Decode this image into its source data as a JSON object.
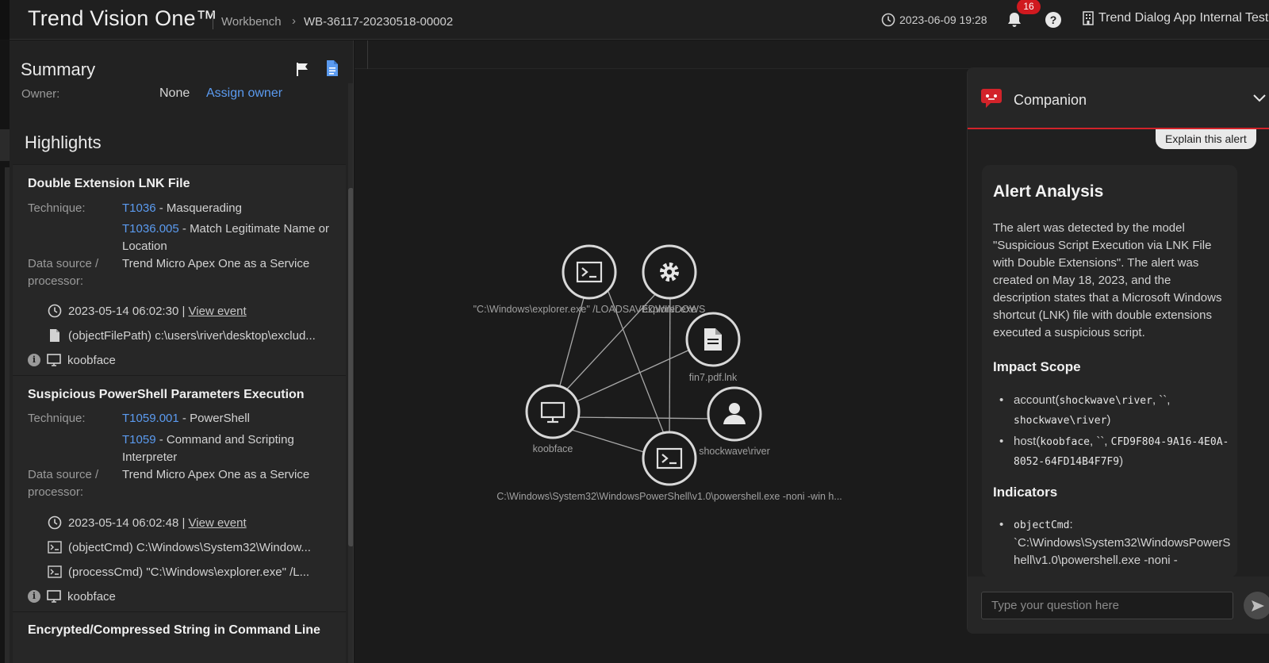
{
  "topbar": {
    "app_title": "Trend Vision One™",
    "breadcrumb_workbench": "Workbench",
    "breadcrumb_separator": "›",
    "breadcrumb_id": "WB-36117-20230518-00002",
    "datetime": "2023-06-09 19:28",
    "notification_count": "16",
    "help_label": "?",
    "tenant_name": "Trend Dialog App Internal Test"
  },
  "summary": {
    "title": "Summary",
    "owner_label": "Owner:",
    "owner_value": "None",
    "assign_owner": "Assign owner"
  },
  "highlights": {
    "title": "Highlights",
    "cards": [
      {
        "title": "Double Extension LNK File",
        "technique_label": "Technique:",
        "techniques": [
          {
            "id": "T1036",
            "name": " - Masquerading"
          },
          {
            "id": "T1036.005",
            "name": " - Match Legitimate Name or Location"
          }
        ],
        "source_label": "Data source / processor:",
        "source_value": "Trend Micro Apex One as a Service",
        "event_time": "2023-05-14 06:02:30 | ",
        "view_event": "View event",
        "rows": [
          "(objectFilePath) c:\\users\\river\\desktop\\exclud..."
        ],
        "host": "koobface"
      },
      {
        "title": "Suspicious PowerShell Parameters Execution",
        "technique_label": "Technique:",
        "techniques": [
          {
            "id": "T1059.001",
            "name": " - PowerShell"
          },
          {
            "id": "T1059",
            "name": " - Command and Scripting Interpreter"
          }
        ],
        "source_label": "Data source / processor:",
        "source_value": "Trend Micro Apex One as a Service",
        "event_time": "2023-05-14 06:02:48 | ",
        "view_event": "View event",
        "rows": [
          "(objectCmd) C:\\Windows\\System32\\Window...",
          "(processCmd) \"C:\\Windows\\explorer.exe\" /L..."
        ],
        "host": "koobface"
      },
      {
        "title": "Encrypted/Compressed String in Command Line"
      }
    ]
  },
  "graph": {
    "nodes": [
      {
        "label": "\"C:\\Windows\\explorer.exe\" /LOADSAVEDWINDOWS",
        "icon": "terminal-icon"
      },
      {
        "label": "explorer.exe",
        "icon": "gear-icon"
      },
      {
        "label": "fin7.pdf.lnk",
        "icon": "file-icon"
      },
      {
        "label": "koobface",
        "icon": "monitor-icon"
      },
      {
        "label": "shockwave\\river",
        "icon": "user-icon"
      },
      {
        "label": "C:\\Windows\\System32\\WindowsPowerShell\\v1.0\\powershell.exe -noni -win h...",
        "icon": "terminal-icon"
      }
    ]
  },
  "companion": {
    "title": "Companion",
    "explain_button": "Explain this alert",
    "analysis_title": "Alert Analysis",
    "analysis_text": "The alert was detected by the model \"Suspicious Script Execution via LNK File with Double Extensions\". The alert was created on May 18, 2023, and the description states that a Microsoft Windows shortcut (LNK) file with double extensions executed a suspicious script.",
    "impact_title": "Impact Scope",
    "impact_account_prefix": "account(",
    "impact_account_1": "shockwave\\river",
    "impact_account_mid": ", ``, ",
    "impact_account_2": "shockwave\\river",
    "impact_account_suffix": ")",
    "impact_host_prefix": "host(",
    "impact_host_1": "koobface",
    "impact_host_mid": ", ``, ",
    "impact_host_2": "CFD9F804-9A16-4E0A-8052-64FD14B4F7F9",
    "impact_host_suffix": ")",
    "indicators_title": "Indicators",
    "indicator_key": "objectCmd",
    "indicator_colon": ":",
    "indicator_value": "`C:\\Windows\\System32\\WindowsPowerShell\\v1.0\\powershell.exe -noni -",
    "input_placeholder": "Type your question here"
  },
  "colors": {
    "accent_blue": "#5b9bf0",
    "brand_red": "#d2232a",
    "badge_red": "#d0191f"
  }
}
